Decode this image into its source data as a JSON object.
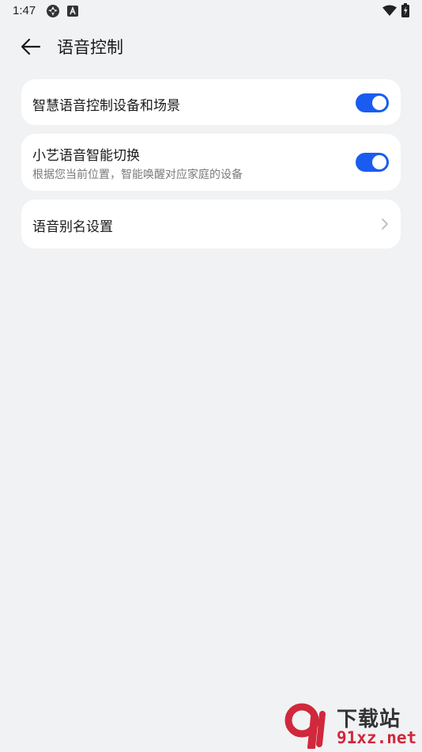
{
  "status_bar": {
    "time": "1:47",
    "icons": [
      "settings-gear-icon",
      "accessibility-a-icon",
      "wifi-icon",
      "battery-charging-icon"
    ]
  },
  "header": {
    "back_icon": "arrow-left-icon",
    "title": "语音控制"
  },
  "settings": [
    {
      "label": "智慧语音控制设备和场景",
      "control": "toggle",
      "enabled": true
    },
    {
      "label": "小艺语音智能切换",
      "subtitle": "根据您当前位置，智能唤醒对应家庭的设备",
      "control": "toggle",
      "enabled": true
    },
    {
      "label": "语音别名设置",
      "control": "chevron-right-icon"
    }
  ],
  "colors": {
    "background": "#f1f2f4",
    "card": "#ffffff",
    "toggle_on": "#1a5cf0",
    "subtitle": "#7a7a7a"
  },
  "watermark": {
    "brand": "下载站",
    "url": "91xz.net"
  }
}
